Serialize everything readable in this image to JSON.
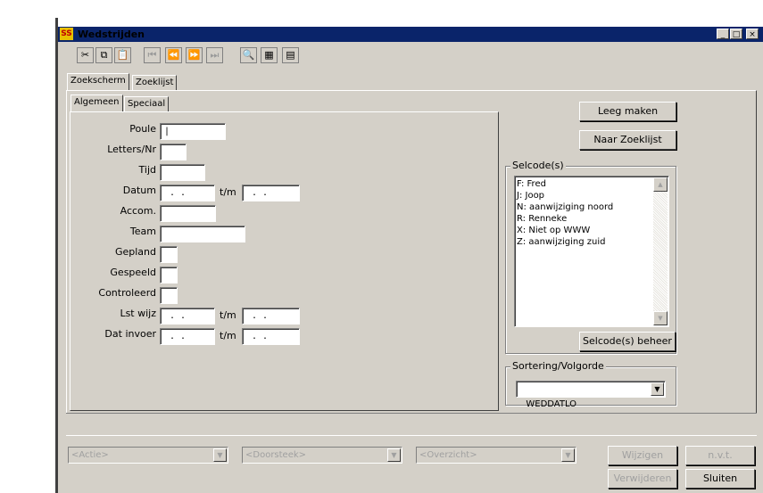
{
  "window": {
    "title": "Wedstrijden",
    "app_icon_text": "SS",
    "controls": {
      "minimize": "_",
      "maximize": "□",
      "close": "×"
    }
  },
  "toolbar": {
    "buttons": [
      {
        "name": "cut",
        "icon": "cut-icon",
        "glyph": "✂"
      },
      {
        "name": "copy",
        "icon": "copy-icon",
        "glyph": "⧉"
      },
      {
        "name": "paste",
        "icon": "paste-icon",
        "glyph": "📋"
      },
      {
        "name": "first",
        "icon": "first-record-icon",
        "glyph": "⏮"
      },
      {
        "name": "previous",
        "icon": "previous-record-icon",
        "glyph": "⏪"
      },
      {
        "name": "next",
        "icon": "next-record-icon",
        "glyph": "⏩"
      },
      {
        "name": "last",
        "icon": "last-record-icon",
        "glyph": "⏭"
      },
      {
        "name": "search",
        "icon": "search-icon",
        "glyph": "🔍"
      },
      {
        "name": "grid",
        "icon": "grid-icon",
        "glyph": "▦"
      },
      {
        "name": "form",
        "icon": "form-icon",
        "glyph": "▤"
      }
    ]
  },
  "tabs": {
    "outer": [
      "Zoekscherm",
      "Zoeklijst"
    ],
    "inner": [
      "Algemeen",
      "Speciaal"
    ]
  },
  "form": {
    "poule": "Poule",
    "letters_nr": "Letters/Nr",
    "tijd": "Tijd",
    "datum": "Datum",
    "accom": "Accom.",
    "team": "Team",
    "gepland": "Gepland",
    "gespeeld": "Gespeeld",
    "controleerd": "Controleerd",
    "lst_wijz": "Lst wijz",
    "dat_invoer": "Dat invoer",
    "tm": "t/m",
    "date_mask": " . .",
    "poule_value": "|"
  },
  "buttons": {
    "leeg_maken": "Leeg maken",
    "naar_zoeklijst": "Naar Zoeklijst",
    "selcode_beheer": "Selcode(s) beheer",
    "wijzigen": "Wijzigen",
    "nvt": "n.v.t.",
    "verwijderen": "Verwijderen",
    "sluiten": "Sluiten"
  },
  "selcodes": {
    "legend": "Selcode(s)",
    "items": [
      "F: Fred",
      "J: Joop",
      "N: aanwijziging noord",
      "R: Renneke",
      "X: Niet op WWW",
      "Z: aanwijziging zuid"
    ]
  },
  "sortering": {
    "legend": "Sortering/Volgorde",
    "value": "WEDDATLO"
  },
  "bottom": {
    "actie": "<Actie>",
    "doorsteek": "<Doorsteek>",
    "overzicht": "<Overzicht>"
  }
}
